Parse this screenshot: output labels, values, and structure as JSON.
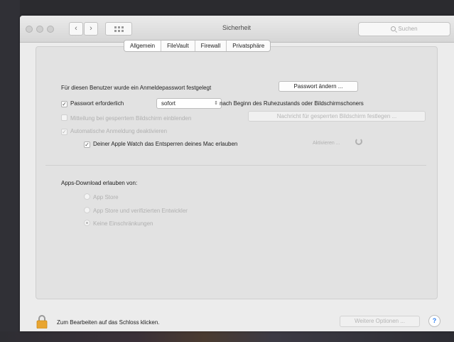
{
  "window": {
    "title": "Sicherheit",
    "search_placeholder": "Suchen"
  },
  "tabs": [
    "Allgemein",
    "FileVault",
    "Firewall",
    "Privatsphäre"
  ],
  "general": {
    "password_set_text": "Für diesen Benutzer wurde ein Anmeldepasswort festgelegt",
    "change_password_button": "Passwort ändern ...",
    "require_password_label": "Passwort erforderlich",
    "require_password_value": "sofort",
    "require_password_suffix": "nach Beginn des Ruhezustands oder Bildschirmschoners",
    "show_message_label": "Mitteilung bei gesperrtem Bildschirm einblenden",
    "set_message_button": "Nachricht für gesperrten Bildschirm festlegen ...",
    "disable_autologin_label": "Automatische Anmeldung deaktivieren",
    "apple_watch_label": "Deiner Apple Watch das Entsperren deines Mac erlauben",
    "activate_label": "Aktivieren ..."
  },
  "downloads": {
    "heading": "Apps-Download erlauben von:",
    "options": [
      "App Store",
      "App Store und verifizierten Entwickler",
      "Keine Einschränkungen"
    ],
    "selected_index": 2
  },
  "footer": {
    "lock_text": "Zum Bearbeiten auf das Schloss klicken.",
    "more_options_button": "Weitere Optionen ...",
    "help_label": "?"
  },
  "colors": {
    "lock": "#e8a531",
    "help": "#2a7ef3"
  }
}
